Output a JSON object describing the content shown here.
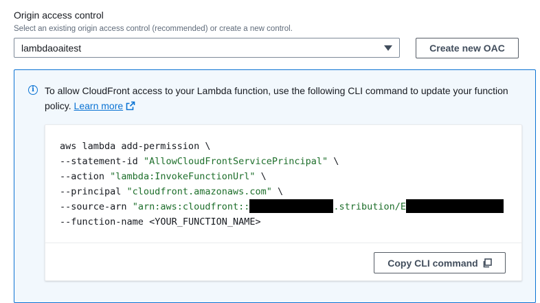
{
  "origin_access_control": {
    "label": "Origin access control",
    "description": "Select an existing origin access control (recommended) or create a new control.",
    "selected_value": "lambdaoaitest",
    "create_button_label": "Create new OAC"
  },
  "info_alert": {
    "icon": "info-icon",
    "message": "To allow CloudFront access to your Lambda function, use the following CLI command to update your function policy.",
    "link_label": "Learn more",
    "link_icon": "external-link-icon"
  },
  "cli": {
    "line1": "aws lambda add-permission \\",
    "statement_flag": "--statement-id",
    "statement_value": "\"AllowCloudFrontServicePrincipal\"",
    "action_flag": "--action",
    "action_value": "\"lambda:InvokeFunctionUrl\"",
    "principal_flag": "--principal",
    "principal_value": "\"cloudfront.amazonaws.com\"",
    "source_flag": "--source-arn",
    "source_value_start": "\"arn:aws:cloudfront::",
    "source_value_mid": ".stribution/E",
    "function_flag": "--function-name",
    "function_value": "<YOUR_FUNCTION_NAME>",
    "line_continuation": "\\",
    "copy_button_label": "Copy CLI command",
    "copy_icon": "copy-icon"
  },
  "colors": {
    "accent": "#0972d3",
    "alert_background": "#f2f8fd",
    "code_string": "#1d6e2a"
  }
}
